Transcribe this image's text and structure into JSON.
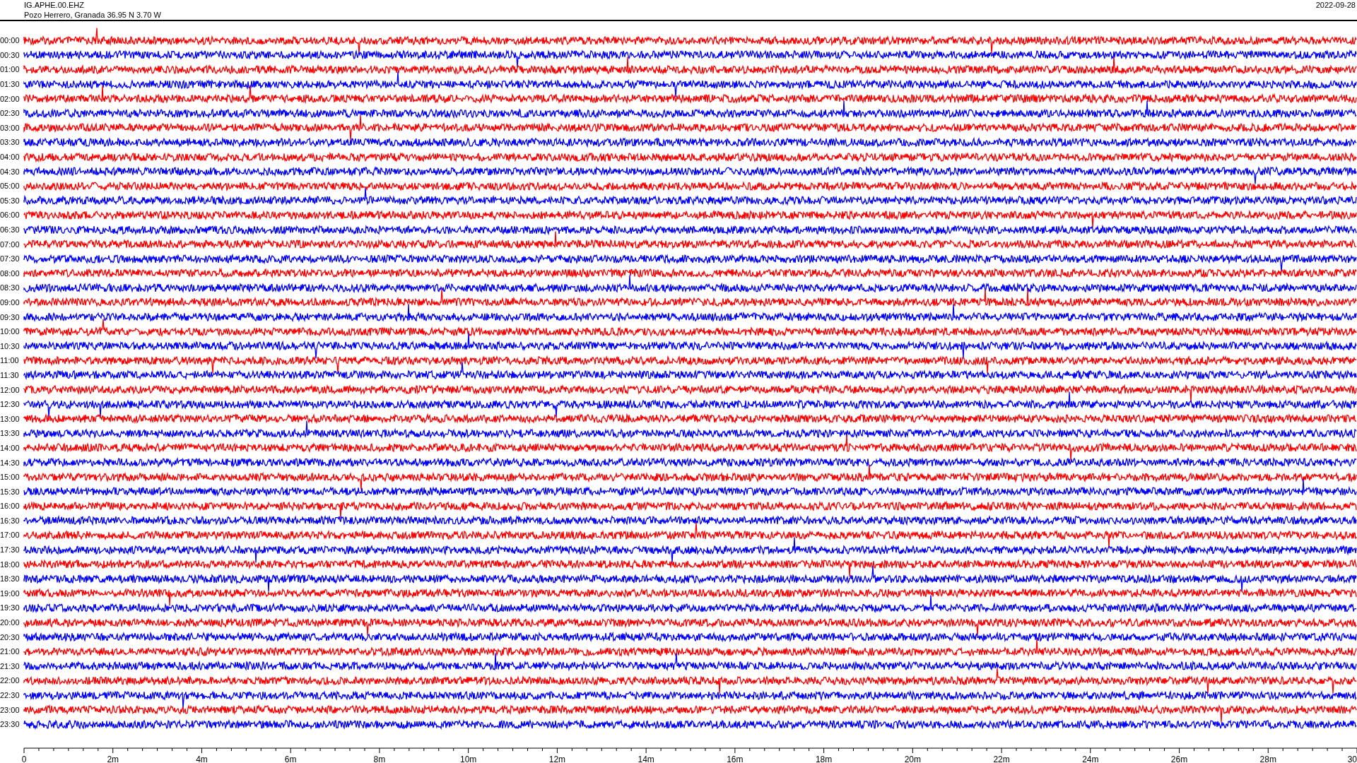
{
  "header": {
    "station": "IG.APHE.00.EHZ",
    "location": "Pozo Herrero, Granada  36.95 N 3.70 W",
    "date": "2022-09-28"
  },
  "rows": [
    {
      "label": "00:00",
      "color": "#ff0000"
    },
    {
      "label": "00:30",
      "color": "#0000ff"
    },
    {
      "label": "01:00",
      "color": "#ff0000"
    },
    {
      "label": "01:30",
      "color": "#0000ff"
    },
    {
      "label": "02:00",
      "color": "#ff0000"
    },
    {
      "label": "02:30",
      "color": "#0000ff"
    },
    {
      "label": "03:00",
      "color": "#ff0000"
    },
    {
      "label": "03:30",
      "color": "#0000ff"
    },
    {
      "label": "04:00",
      "color": "#ff0000"
    },
    {
      "label": "04:30",
      "color": "#0000ff"
    },
    {
      "label": "05:00",
      "color": "#ff0000"
    },
    {
      "label": "05:30",
      "color": "#0000ff"
    },
    {
      "label": "06:00",
      "color": "#ff0000"
    },
    {
      "label": "06:30",
      "color": "#0000ff"
    },
    {
      "label": "07:00",
      "color": "#ff0000"
    },
    {
      "label": "07:30",
      "color": "#0000ff"
    },
    {
      "label": "08:00",
      "color": "#ff0000"
    },
    {
      "label": "08:30",
      "color": "#0000ff"
    },
    {
      "label": "09:00",
      "color": "#ff0000"
    },
    {
      "label": "09:30",
      "color": "#0000ff"
    },
    {
      "label": "10:00",
      "color": "#ff0000"
    },
    {
      "label": "10:30",
      "color": "#0000ff"
    },
    {
      "label": "11:00",
      "color": "#ff0000"
    },
    {
      "label": "11:30",
      "color": "#0000ff"
    },
    {
      "label": "12:00",
      "color": "#ff0000"
    },
    {
      "label": "12:30",
      "color": "#0000ff"
    },
    {
      "label": "13:00",
      "color": "#ff0000"
    },
    {
      "label": "13:30",
      "color": "#0000ff"
    },
    {
      "label": "14:00",
      "color": "#ff0000"
    },
    {
      "label": "14:30",
      "color": "#0000ff"
    },
    {
      "label": "15:00",
      "color": "#ff0000"
    },
    {
      "label": "15:30",
      "color": "#0000ff"
    },
    {
      "label": "16:00",
      "color": "#ff0000"
    },
    {
      "label": "16:30",
      "color": "#0000ff"
    },
    {
      "label": "17:00",
      "color": "#ff0000"
    },
    {
      "label": "17:30",
      "color": "#0000ff"
    },
    {
      "label": "18:00",
      "color": "#ff0000"
    },
    {
      "label": "18:30",
      "color": "#0000ff"
    },
    {
      "label": "19:00",
      "color": "#ff0000"
    },
    {
      "label": "19:30",
      "color": "#0000ff"
    },
    {
      "label": "20:00",
      "color": "#ff0000"
    },
    {
      "label": "20:30",
      "color": "#0000ff"
    },
    {
      "label": "21:00",
      "color": "#ff0000"
    },
    {
      "label": "21:30",
      "color": "#0000ff"
    },
    {
      "label": "22:00",
      "color": "#ff0000"
    },
    {
      "label": "22:30",
      "color": "#0000ff"
    },
    {
      "label": "23:00",
      "color": "#ff0000"
    },
    {
      "label": "23:30",
      "color": "#0000ff"
    }
  ],
  "axis": {
    "labels": [
      "0",
      "2m",
      "4m",
      "6m",
      "8m",
      "10m",
      "12m",
      "14m",
      "16m",
      "18m",
      "20m",
      "22m",
      "24m",
      "26m",
      "28m",
      "30"
    ]
  }
}
